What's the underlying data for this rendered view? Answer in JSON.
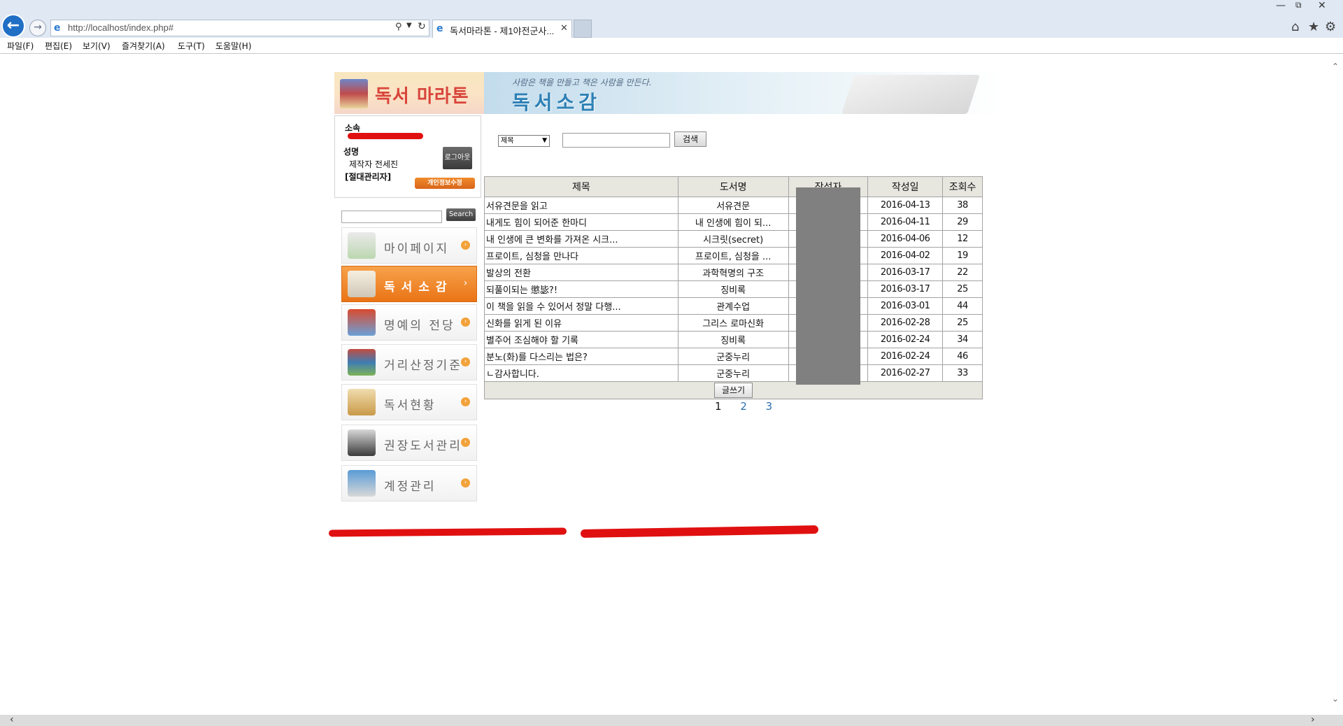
{
  "browser": {
    "url": "http://localhost/index.php#",
    "tab_title": "독서마라톤 - 제1야전군사...",
    "menu": [
      "파일(F)",
      "편집(E)",
      "보기(V)",
      "즐겨찾기(A)",
      "도구(T)",
      "도움말(H)"
    ]
  },
  "site": {
    "logo_text": "독서 마라톤",
    "header_slogan": "사람은 책을 만들고 책은 사람을 만든다.",
    "header_title": "독서소감"
  },
  "profile": {
    "affiliation_label": "소속",
    "name_label": "성명",
    "name_value": "제작자 전세진",
    "role_value": "[절대관리자]",
    "logout_label": "로그아웃",
    "edit_label": "개인정보수정"
  },
  "side_search": {
    "button_label": "Search"
  },
  "nav": {
    "items": [
      {
        "label": "마이페이지",
        "active": false,
        "icon": "mypage-icon"
      },
      {
        "label": "독서소감",
        "active": true,
        "icon": "clipboard-icon"
      },
      {
        "label": "명예의 전당",
        "active": false,
        "icon": "trophy-icon"
      },
      {
        "label": "거리산정기준",
        "active": false,
        "icon": "book-stack-icon"
      },
      {
        "label": "독서현황",
        "active": false,
        "icon": "magnifier-icon"
      },
      {
        "label": "권장도서관리",
        "active": false,
        "icon": "laptop-icon"
      },
      {
        "label": "계정관리",
        "active": false,
        "icon": "monitor-icon"
      }
    ]
  },
  "search": {
    "field_selected": "제목",
    "button_label": "검색"
  },
  "board": {
    "headers": [
      "제목",
      "도서명",
      "작성자",
      "작성일",
      "조회수"
    ],
    "rows": [
      {
        "title": "서유견문을 읽고",
        "book": "서유견문",
        "date": "2016-04-13",
        "views": "38"
      },
      {
        "title": "내게도 힘이 되어준 한마디",
        "book": "내 인생에 힘이 되...",
        "date": "2016-04-11",
        "views": "29"
      },
      {
        "title": "내 인생에 큰 변화를 가져온 시크...",
        "book": "시크릿(secret)",
        "date": "2016-04-06",
        "views": "12"
      },
      {
        "title": "프로이트, 심청을 만나다",
        "book": "프로이트, 심청을 ...",
        "date": "2016-04-02",
        "views": "19"
      },
      {
        "title": "발상의 전환",
        "book": "과학혁명의 구조",
        "date": "2016-03-17",
        "views": "22"
      },
      {
        "title": "되풀이되는 懲毖?!",
        "book": "징비록",
        "date": "2016-03-17",
        "views": "25"
      },
      {
        "title": "이 책을 읽을 수 있어서 정말 다행...",
        "book": "관계수업",
        "date": "2016-03-01",
        "views": "44"
      },
      {
        "title": "신화를 읽게 된 이유",
        "book": "그리스 로마신화",
        "date": "2016-02-28",
        "views": "25"
      },
      {
        "title": "별주어 조심해야 할 기록",
        "book": "징비록",
        "date": "2016-02-24",
        "views": "34"
      },
      {
        "title": "분노(화)를 다스리는 법은?",
        "book": "군중누리",
        "date": "2016-02-24",
        "views": "46"
      },
      {
        "title": "  ㄴ감사합니다.",
        "book": "군중누리",
        "date": "2016-02-27",
        "views": "33"
      }
    ],
    "write_label": "글쓰기"
  },
  "pagination": [
    "1",
    "2",
    "3"
  ],
  "colors": {
    "accent_orange": "#ea7416",
    "header_blue": "#2d80b5",
    "redaction_red": "#e01010"
  }
}
